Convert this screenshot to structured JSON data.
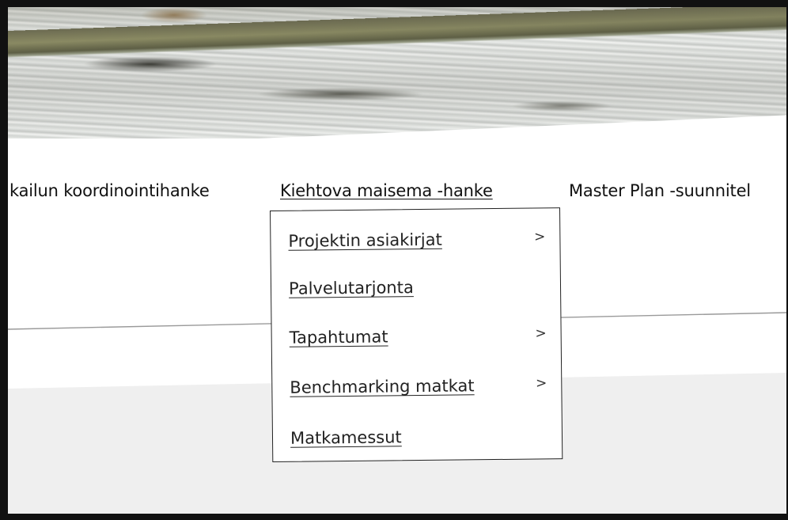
{
  "nav": {
    "items": [
      {
        "label": "kailun koordinointihanke",
        "active": false
      },
      {
        "label": "Kiehtova maisema -hanke",
        "active": true
      },
      {
        "label": "Master Plan -suunnitel",
        "active": false
      }
    ]
  },
  "dropdown": {
    "items": [
      {
        "label": "Projektin asiakirjat",
        "has_submenu": true,
        "chevron": ">"
      },
      {
        "label": "Palvelutarjonta",
        "has_submenu": false,
        "chevron": ""
      },
      {
        "label": "Tapahtumat",
        "has_submenu": true,
        "chevron": ">"
      },
      {
        "label": "Benchmarking matkat",
        "has_submenu": true,
        "chevron": ">"
      },
      {
        "label": "Matkamessut",
        "has_submenu": false,
        "chevron": ""
      }
    ]
  },
  "colors": {
    "frame": "#111111",
    "text": "#111111",
    "grey_band": "#efefef",
    "divider": "#999999"
  }
}
